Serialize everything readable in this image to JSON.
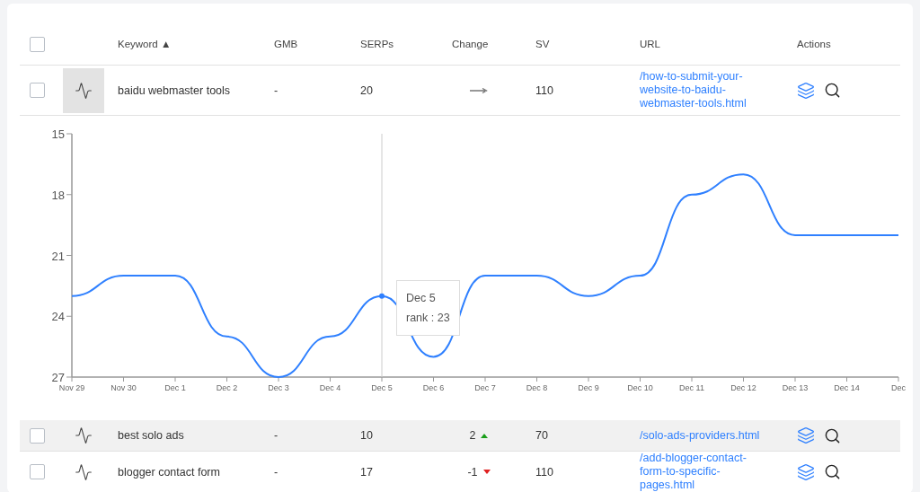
{
  "table": {
    "header": {
      "checked": false,
      "columns": [
        {
          "label": "Keyword",
          "sort_indicator": "▲"
        },
        {
          "label": "GMB"
        },
        {
          "label": "SERPs"
        },
        {
          "label": "Change"
        },
        {
          "label": "SV"
        },
        {
          "label": "URL"
        },
        {
          "label": "Actions"
        }
      ]
    },
    "rows": [
      {
        "checked": false,
        "expanded": true,
        "highlighted": false,
        "keyword": "baidu webmaster tools",
        "gmb": "-",
        "serps": "20",
        "change": {
          "kind": "flat"
        },
        "sv": "110",
        "url": "/how-to-submit-your-website-to-baidu-webmaster-tools.html",
        "chart_data": {
          "type": "line",
          "categories": [
            "Nov 29",
            "Nov 30",
            "Dec 1",
            "Dec 2",
            "Dec 3",
            "Dec 4",
            "Dec 5",
            "Dec 6",
            "Dec 7",
            "Dec 8",
            "Dec 9",
            "Dec 10",
            "Dec 11",
            "Dec 12",
            "Dec 13",
            "Dec 14",
            "Dec"
          ],
          "series": [
            {
              "color": "#2f80ff",
              "values": [
                23,
                22,
                22,
                25,
                27,
                25,
                23,
                26,
                22,
                22,
                23,
                22,
                18,
                17,
                20,
                20,
                20
              ]
            }
          ],
          "ylim": [
            27,
            15
          ],
          "yticks": [
            15,
            18,
            21,
            24,
            27
          ],
          "annotations": [
            {
              "x": "Dec 5",
              "y": 23,
              "text": "rank : 23"
            }
          ]
        }
      },
      {
        "checked": false,
        "expanded": false,
        "highlighted": true,
        "keyword": "best solo ads",
        "gmb": "-",
        "serps": "10",
        "change": {
          "kind": "up",
          "text": "2"
        },
        "sv": "70",
        "url": "/solo-ads-providers.html"
      },
      {
        "checked": false,
        "expanded": false,
        "highlighted": false,
        "keyword": "blogger contact form",
        "gmb": "-",
        "serps": "17",
        "change": {
          "kind": "down",
          "text": "-1"
        },
        "sv": "110",
        "url": "/add-blogger-contact-form-to-specific-pages.html"
      }
    ]
  }
}
